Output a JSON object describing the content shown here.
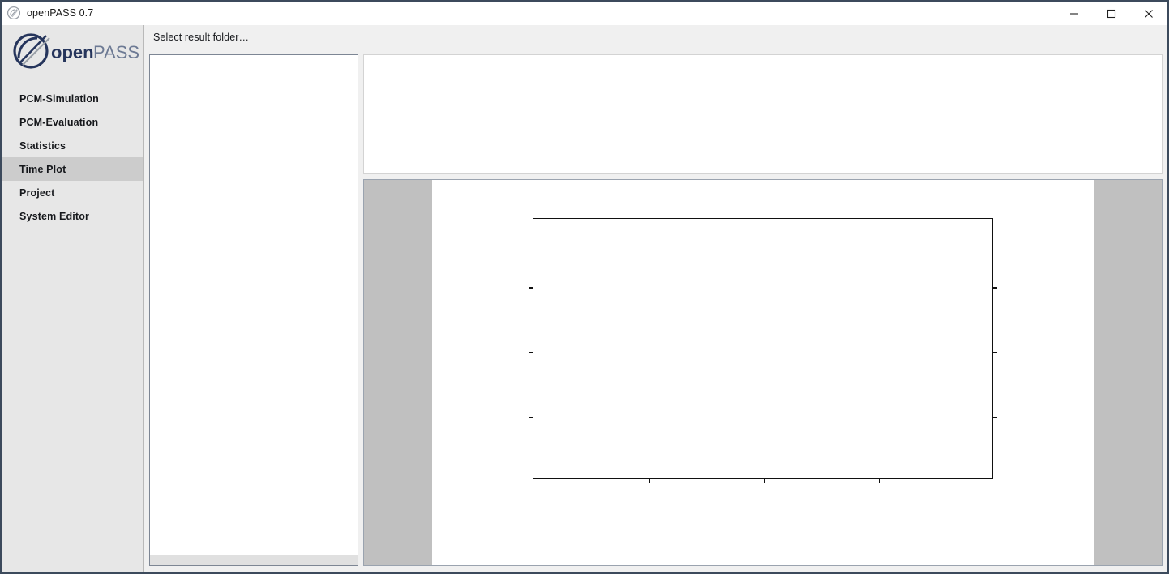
{
  "window": {
    "title": "openPASS 0.7",
    "icon": "openpass-logo-icon",
    "controls": {
      "minimize_label": "Minimize",
      "maximize_label": "Maximize",
      "close_label": "Close"
    }
  },
  "sidebar": {
    "logo": {
      "text_open": "open",
      "text_pass": "PASS"
    },
    "items": [
      {
        "label": "PCM-Simulation",
        "selected": false
      },
      {
        "label": "PCM-Evaluation",
        "selected": false
      },
      {
        "label": "Statistics",
        "selected": false
      },
      {
        "label": "Time Plot",
        "selected": true
      },
      {
        "label": "Project",
        "selected": false
      },
      {
        "label": "System Editor",
        "selected": false
      }
    ]
  },
  "toolbar": {
    "select_result_folder_label": "Select result folder…"
  },
  "main": {
    "left_panel": {
      "items": [],
      "scrollbar_visible": true
    },
    "legend_panel": {
      "items": []
    }
  },
  "colors": {
    "window_border": "#3c4a5c",
    "sidebar_bg": "#e7e7e7",
    "sidebar_selected_bg": "#cccccc",
    "content_bg": "#f0f0f0",
    "panel_bg": "#ffffff",
    "plot_surround": "#c0c0c0",
    "axes_line": "#111111",
    "brand_dark": "#26355c",
    "brand_light": "#6d7a94"
  },
  "chart_data": {
    "type": "line",
    "title": "",
    "xlabel": "",
    "ylabel": "",
    "series": [],
    "x": [],
    "categories": [],
    "values": [],
    "xticks": [],
    "yticks": [],
    "xtick_count": 3,
    "ytick_count": 3,
    "grid": false,
    "legend": "none",
    "empty": true,
    "note": "Empty axes box — no data plotted, no tick labels rendered"
  }
}
